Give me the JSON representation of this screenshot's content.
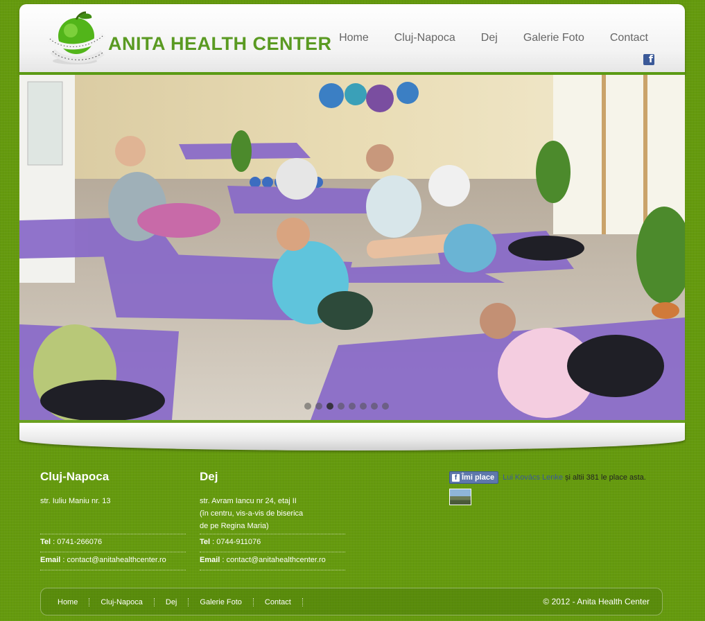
{
  "header": {
    "brand": "ANITA HEALTH CENTER",
    "nav": [
      "Home",
      "Cluj-Napoca",
      "Dej",
      "Galerie Foto",
      "Contact"
    ]
  },
  "slider": {
    "slide_count": 8,
    "active_slide": 3
  },
  "locations": [
    {
      "title": "Cluj-Napoca",
      "address": [
        "str. Iuliu Maniu nr. 13"
      ],
      "tel_label": "Tel",
      "tel": "0741-266076",
      "email_label": "Email",
      "email": "contact@anitahealthcenter.ro"
    },
    {
      "title": "Dej",
      "address": [
        "str. Avram Iancu nr 24, etaj II",
        "(în centru, vis-a-vis de biserica",
        "de pe Regina Maria)"
      ],
      "tel_label": "Tel",
      "tel": "0744-911076",
      "email_label": "Email",
      "email": "contact@anitahealthcenter.ro"
    }
  ],
  "facebook": {
    "like_button": "Îmi place",
    "friend_name": "Lui Kovács Lenke",
    "like_text": "și altii 381 le place asta."
  },
  "footer": {
    "nav": [
      "Home",
      "Cluj-Napoca",
      "Dej",
      "Galerie Foto",
      "Contact"
    ],
    "copyright": "© 2012 - Anita Health Center"
  },
  "colors": {
    "background": "#659a0e",
    "brand_green": "#5a9a22",
    "facebook_blue": "#3b5998"
  }
}
